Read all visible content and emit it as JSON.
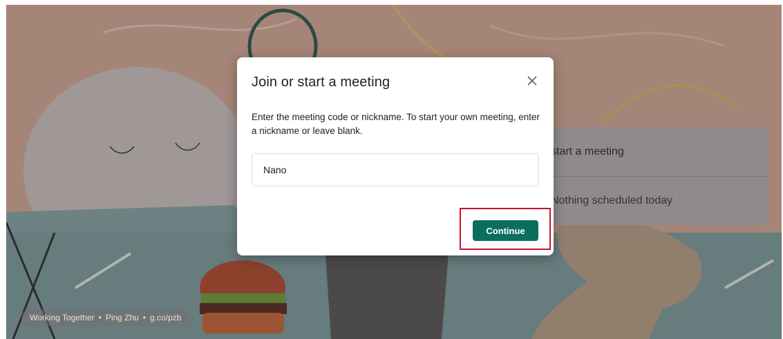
{
  "dialog": {
    "title": "Join or start a meeting",
    "description": "Enter the meeting code or nickname. To start your own meeting, enter a nickname or leave blank.",
    "input_value": "Nano",
    "continue_label": "Continue",
    "close_icon": "close-icon"
  },
  "side_panel": {
    "row1": "start a meeting",
    "row2": "Nothing scheduled today"
  },
  "attribution": {
    "title": "Working Together",
    "author": "Ping Zhu",
    "link": "g.co/pzb",
    "separator": "•"
  },
  "colors": {
    "accent": "#0b6e5f",
    "highlight": "#c8102e"
  }
}
